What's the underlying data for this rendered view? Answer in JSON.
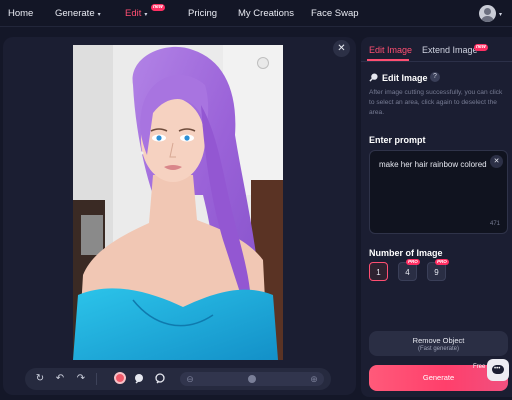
{
  "nav": {
    "home": "Home",
    "generate": "Generate",
    "edit": "Edit",
    "edit_badge": "new",
    "pricing": "Pricing",
    "my_creations": "My Creations",
    "face_swap": "Face Swap",
    "caret": "▾"
  },
  "canvas": {
    "close": "✕",
    "photo_icon": "portrait-photo",
    "tools": {
      "rotate": "↻",
      "undo": "↶",
      "redo": "↷"
    },
    "zoom_level": 0.5
  },
  "panel": {
    "tabs": {
      "edit_image": "Edit Image",
      "extend_image": "Extend Image",
      "extend_badge": "new"
    },
    "edit_section_title": "Edit Image",
    "help": "?",
    "description": "After image cutting successfully, you can click to select an area, click again to deselect the area.",
    "prompt_label": "Enter prompt",
    "prompt_value": "make her hair rainbow colored",
    "prompt_clear": "✕",
    "prompt_count": "471",
    "number_label": "Number of Image",
    "number_options": [
      "1",
      "4",
      "9"
    ],
    "number_pro_badge": "PRO",
    "selected_number": "1",
    "remove_object": "Remove Object",
    "remove_object_sub": "(Fast generate)",
    "generate": "Generate",
    "free_tag": "Free"
  },
  "colors": {
    "accent": "#ff4f72",
    "background": "#141728",
    "panel": "#1b1e32"
  }
}
